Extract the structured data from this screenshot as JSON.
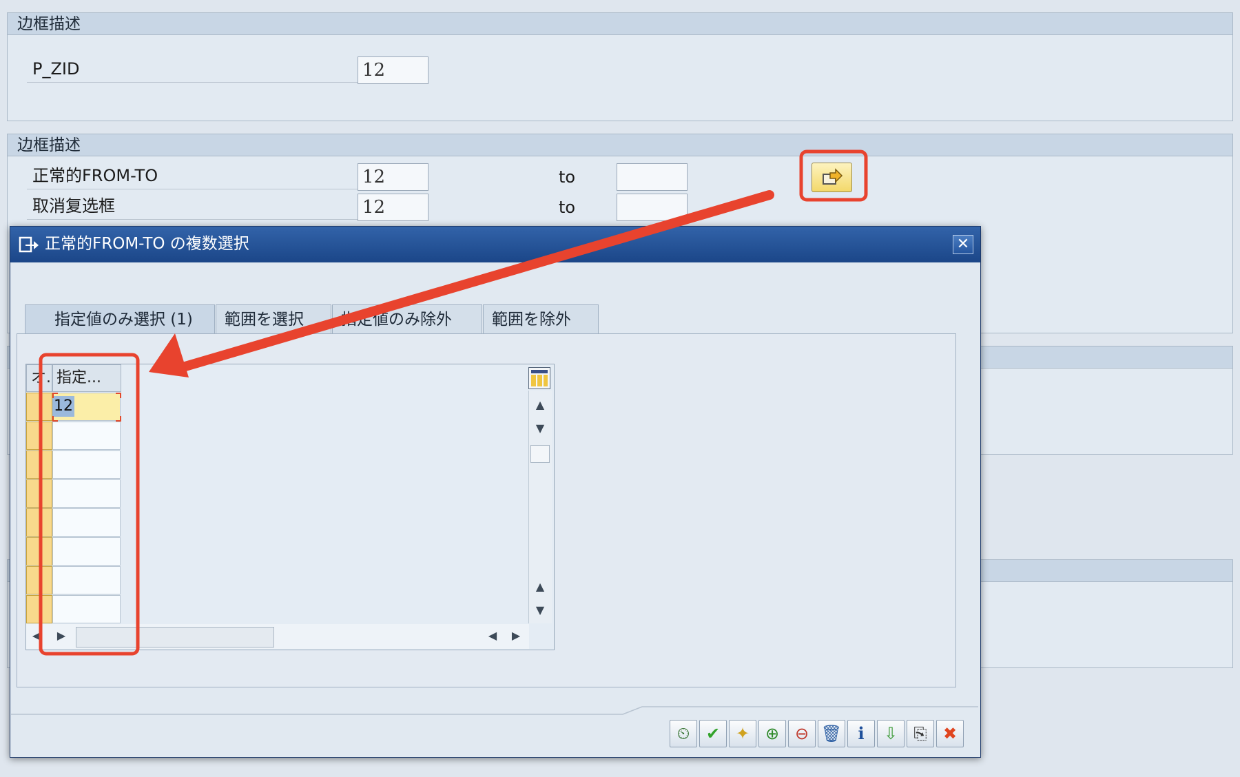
{
  "background": {
    "frame1": {
      "title": "边框描述",
      "label": "P_ZID",
      "value": "12"
    },
    "frame2": {
      "title": "边框描述",
      "rows": [
        {
          "label": "正常的FROM-TO",
          "from": "12",
          "to_label": "to",
          "to_value": ""
        },
        {
          "label": "取消复选框",
          "from": "12",
          "to_label": "to",
          "to_value": ""
        }
      ],
      "multiple_selection_icon": "arrow-right-icon"
    }
  },
  "dialog": {
    "title": "正常的FROM-TO の複数選択",
    "title_icon": "multiple-selection-icon",
    "close_icon": "close-icon",
    "tabs": [
      {
        "label": "指定値のみ選択 (1)",
        "active": true
      },
      {
        "label": "範囲を選択",
        "active": false
      },
      {
        "label": "指定値のみ除外",
        "active": false
      },
      {
        "label": "範囲を除外",
        "active": false
      }
    ],
    "grid": {
      "col_option_header": "オ.",
      "col_value_header": "指定...",
      "rows": [
        "12",
        "",
        "",
        "",
        "",
        "",
        "",
        ""
      ],
      "layout_icon": "column-layout-icon"
    },
    "footer_buttons": [
      {
        "icon": "execute-icon",
        "symbol": "⏲"
      },
      {
        "icon": "check-icon",
        "symbol": "✔"
      },
      {
        "icon": "options-icon",
        "symbol": "✦"
      },
      {
        "icon": "insert-row-icon",
        "symbol": "⊕"
      },
      {
        "icon": "delete-row-icon",
        "symbol": "⊖"
      },
      {
        "icon": "trash-icon",
        "symbol": "🗑"
      },
      {
        "icon": "info-icon",
        "symbol": "i"
      },
      {
        "icon": "import-icon",
        "symbol": "⇩"
      },
      {
        "icon": "paste-icon",
        "symbol": "⎘"
      },
      {
        "icon": "cancel-icon",
        "symbol": "✖"
      }
    ]
  },
  "colors": {
    "annotation": "#e8432e",
    "dialog_title_bg": "#1b4688",
    "highlight_cell": "#fbeea8"
  }
}
